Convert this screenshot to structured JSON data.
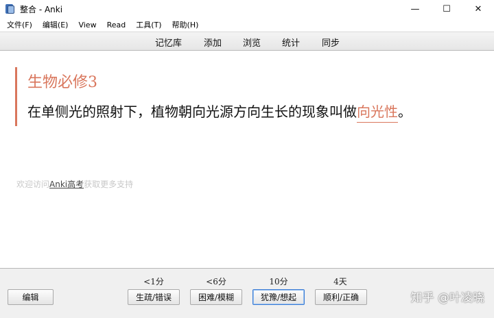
{
  "window": {
    "title": "整合 - Anki",
    "controls": {
      "minimize": "—",
      "maximize": "☐",
      "close": "✕"
    }
  },
  "menu": {
    "items": [
      "文件(F)",
      "编辑(E)",
      "View",
      "Read",
      "工具(T)",
      "帮助(H)"
    ]
  },
  "toolbar": {
    "items": [
      "记忆库",
      "添加",
      "浏览",
      "统计",
      "同步"
    ]
  },
  "card": {
    "title": "生物必修3",
    "body_prefix": "在单侧光的照射下，植物朝向光源方向生长的现象叫做",
    "answer": "向光性",
    "body_suffix": "。",
    "promo_before": "欢迎访问",
    "promo_link": "Anki高考",
    "promo_after": "获取更多支持"
  },
  "bottom": {
    "edit_label": "编辑",
    "answers": [
      {
        "interval": "<1分",
        "label": "生疏/错误"
      },
      {
        "interval": "<6分",
        "label": "困难/模糊"
      },
      {
        "interval": "10分",
        "label": "犹豫/想起"
      },
      {
        "interval": "4天",
        "label": "顺利/正确"
      }
    ],
    "watermark": "知乎 @叶凌晓"
  }
}
